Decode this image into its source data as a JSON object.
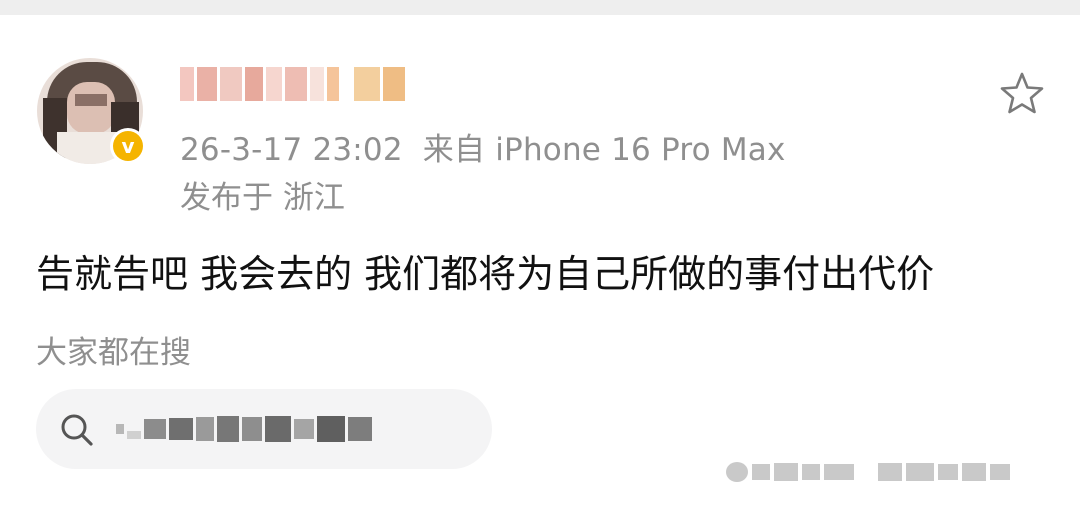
{
  "post": {
    "timestamp": "26-3-17 23:02",
    "source": "来自 iPhone 16 Pro Max",
    "location": "发布于 浙江",
    "content": "告就告吧 我会去的 我们都将为自己所做的事付出代价"
  },
  "search": {
    "title": "大家都在搜"
  },
  "icons": {
    "verified": "verified-v-badge-icon",
    "favorite": "star-outline-icon",
    "search": "search-icon"
  },
  "colors": {
    "text_primary": "#111111",
    "text_secondary": "#8f8f8f",
    "verified_badge": "#f5b400",
    "search_background": "#f4f4f5"
  }
}
